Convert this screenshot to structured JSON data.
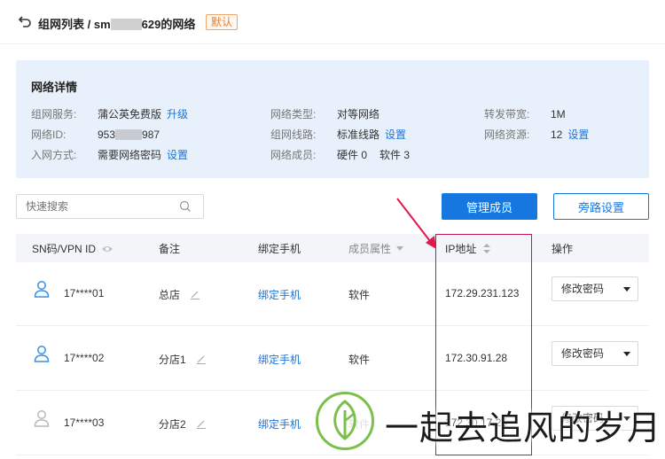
{
  "header": {
    "breadcrumb_parent": "组网列表 / sm",
    "breadcrumb_suffix": "629的网络",
    "default_tag": "默认"
  },
  "details": {
    "title": "网络详情",
    "service_label": "组网服务:",
    "service_value": "蒲公英免费版",
    "service_link": "升级",
    "network_id_label": "网络ID:",
    "network_id_prefix": "953",
    "network_id_suffix": "987",
    "join_label": "入网方式:",
    "join_value": "需要网络密码",
    "join_link": "设置",
    "type_label": "网络类型:",
    "type_value": "对等网络",
    "line_label": "组网线路:",
    "line_value": "标准线路",
    "line_link": "设置",
    "members_label": "网络成员:",
    "members_hw": "硬件 0",
    "members_sw": "软件 3",
    "bandwidth_label": "转发带宽:",
    "bandwidth_value": "1M",
    "resource_label": "网络资源:",
    "resource_value": "12",
    "resource_link": "设置"
  },
  "toolbar": {
    "search_placeholder": "快速搜索",
    "manage_members": "管理成员",
    "bypass_settings": "旁路设置"
  },
  "table": {
    "headers": [
      "SN码/VPN ID",
      "备注",
      "绑定手机",
      "成员属性",
      "IP地址",
      "操作"
    ],
    "rows": [
      {
        "id": "17****01",
        "note": "总店",
        "phone": "绑定手机",
        "attr": "软件",
        "ip": "172.29.231.123",
        "action": "修改密码",
        "online": true
      },
      {
        "id": "17****02",
        "note": "分店1",
        "phone": "绑定手机",
        "attr": "软件",
        "ip": "172.30.91.28",
        "action": "修改密码",
        "online": true
      },
      {
        "id": "17****03",
        "note": "分店2",
        "phone": "绑定手机",
        "attr": "软件",
        "ip": "172.30.17.25",
        "action": "修改密码",
        "online": false
      }
    ]
  },
  "watermark": {
    "text": "一起去追风的岁月"
  },
  "colors": {
    "accent": "#1677e0",
    "link": "#1a73d9",
    "panel_bg": "#e8f1fb",
    "tag_orange": "#f07a2a",
    "highlight": "#c2185b",
    "online_user": "#3a8ee6",
    "offline_user": "#b8b8b8"
  }
}
